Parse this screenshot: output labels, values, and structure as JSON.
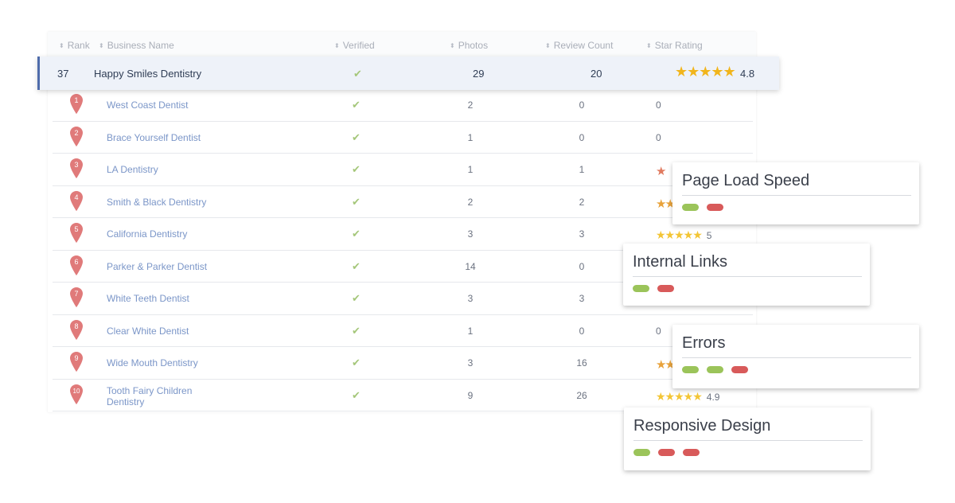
{
  "headers": {
    "rank": "Rank",
    "name": "Business Name",
    "verified": "Verified",
    "photos": "Photos",
    "reviews": "Review Count",
    "rating": "Star Rating"
  },
  "highlight": {
    "rank": "37",
    "name": "Happy Smiles Dentistry",
    "check": "✔",
    "photos": "29",
    "reviews": "20",
    "stars": "★★★★★",
    "rating": "4.8"
  },
  "rows": [
    {
      "rank": "1",
      "name": "West Coast Dentist",
      "check": "✔",
      "photos": "2",
      "reviews": "0",
      "rating": "0"
    },
    {
      "rank": "2",
      "name": "Brace Yourself Dentist",
      "check": "✔",
      "photos": "1",
      "reviews": "0",
      "rating": "0"
    },
    {
      "rank": "3",
      "name": "LA Dentistry",
      "check": "✔",
      "photos": "1",
      "reviews": "1",
      "rating_star": "★"
    },
    {
      "rank": "4",
      "name": "Smith & Black Dentistry",
      "check": "✔",
      "photos": "2",
      "reviews": "2",
      "rating_star": "★★"
    },
    {
      "rank": "5",
      "name": "California Dentistry",
      "check": "✔",
      "photos": "3",
      "reviews": "3",
      "rating_star": "★★★★★",
      "rating": "5"
    },
    {
      "rank": "6",
      "name": "Parker & Parker Dentist",
      "check": "✔",
      "photos": "14",
      "reviews": "0"
    },
    {
      "rank": "7",
      "name": "White Teeth Dentist",
      "check": "✔",
      "photos": "3",
      "reviews": "3"
    },
    {
      "rank": "8",
      "name": "Clear White Dentist",
      "check": "✔",
      "photos": "1",
      "reviews": "0",
      "rating": "0"
    },
    {
      "rank": "9",
      "name": "Wide Mouth Dentistry",
      "check": "✔",
      "photos": "3",
      "reviews": "16",
      "rating_star": "★★"
    },
    {
      "rank": "10",
      "name_line1": "Tooth Fairy Children",
      "name_line2": "Dentistry",
      "check": "✔",
      "photos": "9",
      "reviews": "26",
      "rating_star": "★★★★★",
      "rating": "4.9"
    }
  ],
  "cards": {
    "page_load": {
      "title": "Page Load Speed",
      "pills": [
        "green",
        "red"
      ]
    },
    "internal_links": {
      "title": "Internal Links",
      "pills": [
        "green",
        "red"
      ]
    },
    "errors": {
      "title": "Errors",
      "pills": [
        "green",
        "green",
        "red"
      ]
    },
    "responsive": {
      "title": "Responsive Design",
      "pills": [
        "green",
        "red",
        "red"
      ]
    }
  },
  "colors": {
    "accent": "#4f6cab",
    "pin": "#e07a7a",
    "check": "#a5c77a",
    "star": "#f3c535",
    "pill_green": "#9bc45a",
    "pill_red": "#d85a5a"
  }
}
